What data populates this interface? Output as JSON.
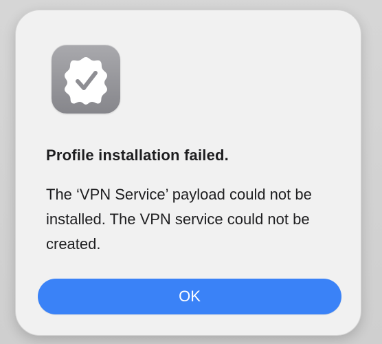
{
  "dialog": {
    "icon": "verified-badge-checkmark-icon",
    "title": "Profile installation failed.",
    "message": "The ‘VPN Service’ payload could not be installed. The VPN service could not be created.",
    "ok_label": "OK"
  },
  "colors": {
    "accent": "#3a82f7",
    "dialog_background": "#f1f1f1",
    "icon_background": "#96969b"
  }
}
